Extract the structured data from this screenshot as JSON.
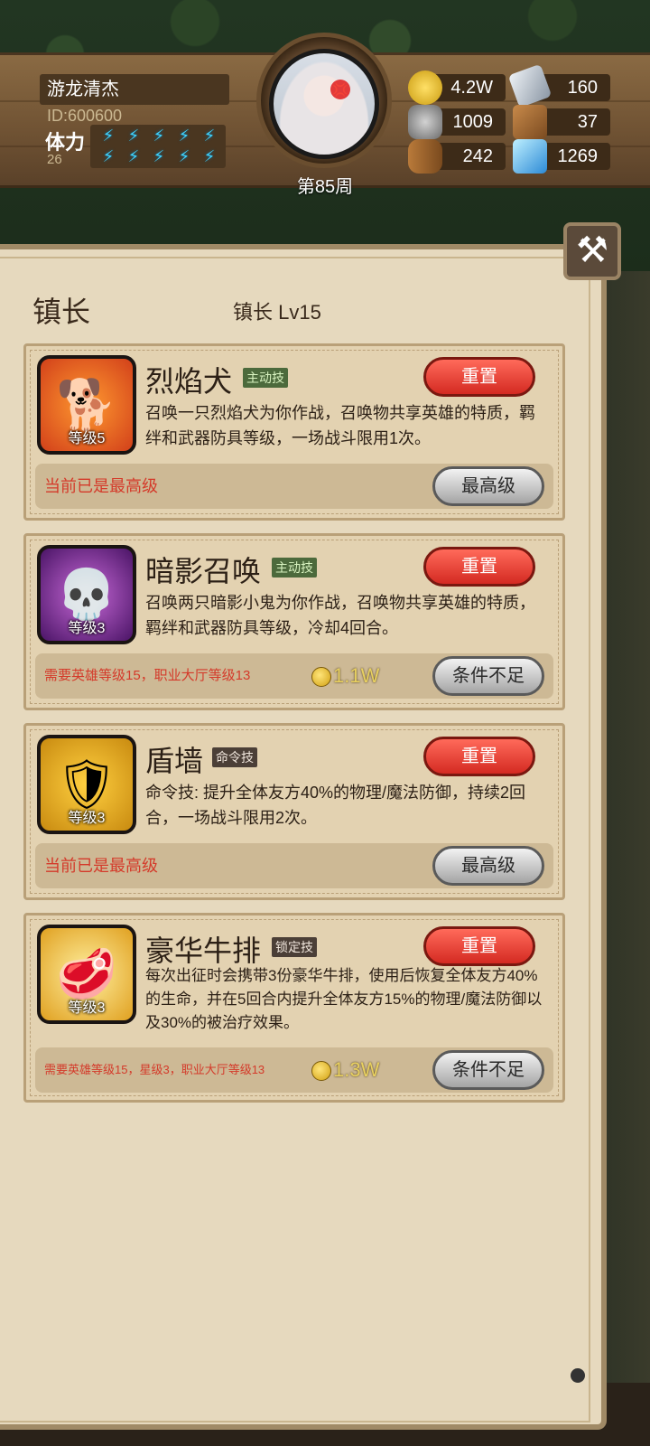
{
  "player": {
    "name": "游龙清杰",
    "id": "ID:600600",
    "stamina_label": "体力",
    "stamina_value": "26",
    "week": "第85周"
  },
  "resources": [
    {
      "icon": "gold-coin-icon",
      "value": "4.2W"
    },
    {
      "icon": "iron-ingot-icon",
      "value": "160"
    },
    {
      "icon": "stone-ore-icon",
      "value": "1009"
    },
    {
      "icon": "leather-icon",
      "value": "37"
    },
    {
      "icon": "wood-log-icon",
      "value": "242"
    },
    {
      "icon": "crystal-icon",
      "value": "1269"
    }
  ],
  "panel": {
    "title": "镇长",
    "subtitle": "镇长 Lv15",
    "close_symbol": "⚒"
  },
  "skills": [
    {
      "name": "烈焰犬",
      "tag": "主动技",
      "level": "等级5",
      "reset_label": "重置",
      "desc": "召唤一只烈焰犬为你作战，召唤物共享英雄的特质，羁绊和武器防具等级，一场战斗限用1次。",
      "requirement": "当前已是最高级",
      "cost": "",
      "button": "最高级"
    },
    {
      "name": "暗影召唤",
      "tag": "主动技",
      "level": "等级3",
      "reset_label": "重置",
      "desc": "召唤两只暗影小鬼为你作战，召唤物共享英雄的特质，羁绊和武器防具等级，冷却4回合。",
      "requirement": "需要英雄等级15，职业大厅等级13",
      "cost": "1.1W",
      "button": "条件不足"
    },
    {
      "name": "盾墙",
      "tag": "命令技",
      "level": "等级3",
      "reset_label": "重置",
      "desc": "命令技: 提升全体友方40%的物理/魔法防御，持续2回合，一场战斗限用2次。",
      "requirement": "当前已是最高级",
      "cost": "",
      "button": "最高级"
    },
    {
      "name": "豪华牛排",
      "tag": "锁定技",
      "level": "等级3",
      "reset_label": "重置",
      "desc": "每次出征时会携带3份豪华牛排，使用后恢复全体友方40%的生命，并在5回合内提升全体友方15%的物理/魔法防御以及30%的被治疗效果。",
      "requirement": "需要英雄等级15，星级3，职业大厅等级13",
      "cost": "1.3W",
      "button": "条件不足"
    }
  ],
  "colors": {
    "reset_red": "#d42a22",
    "requirement_red": "#d43a2a",
    "panel_bg": "#e6d9be",
    "stamina_blue": "#3fd4ff"
  }
}
